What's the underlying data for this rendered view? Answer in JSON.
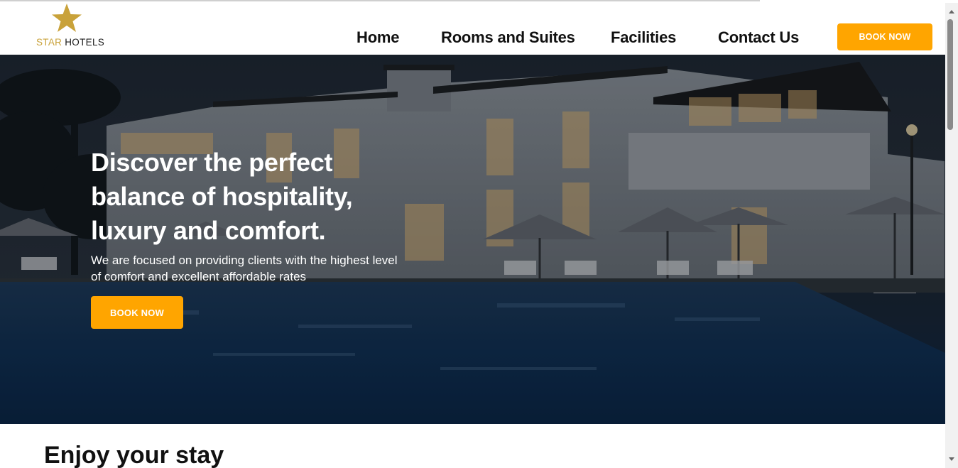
{
  "header": {
    "logo": {
      "word_star": "STAR",
      "word_hotels": " HOTELS",
      "icon": "star-icon",
      "colors": {
        "star": "#c9a23a",
        "text": "#1a1a1a"
      }
    },
    "nav": [
      {
        "label": "Home"
      },
      {
        "label": "Rooms and Suites"
      },
      {
        "label": "Facilities"
      },
      {
        "label": "Contact Us"
      }
    ],
    "book_button": "BOOK NOW"
  },
  "hero": {
    "title": "Discover the perfect balance of hospitality, luxury and comfort.",
    "subtitle": "We are focused on providing clients with the highest level of comfort and excellent affordable rates",
    "button": "BOOK NOW"
  },
  "next_section": {
    "title": "Enjoy your stay"
  },
  "colors": {
    "accent": "#ffa500",
    "text_dark": "#111111",
    "text_light": "#ffffff"
  }
}
